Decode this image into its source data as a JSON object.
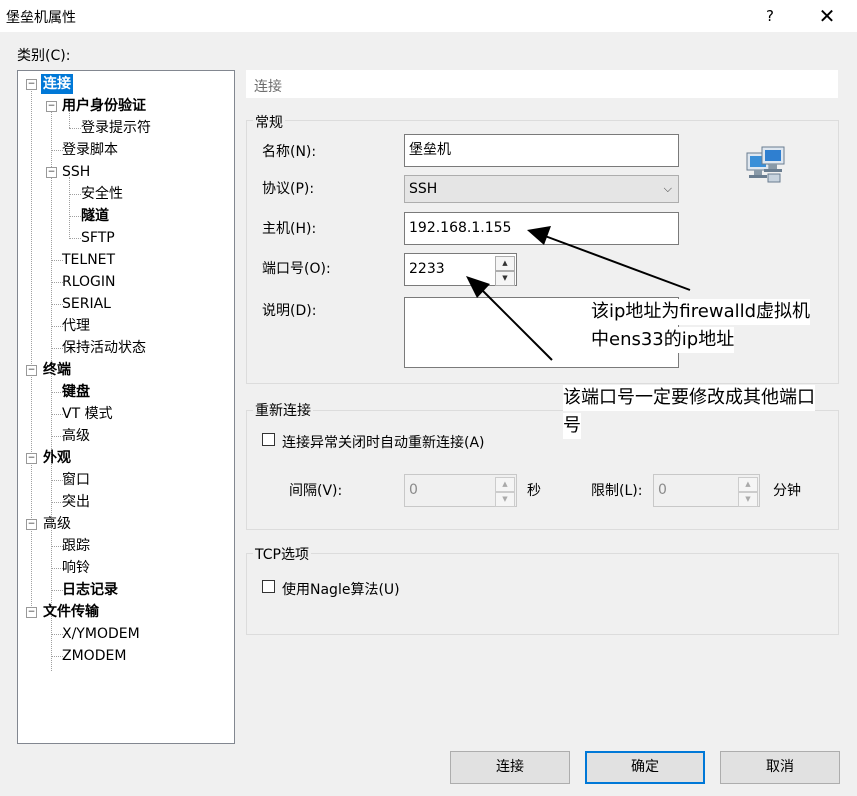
{
  "window": {
    "title": "堡垒机属性",
    "help": "?",
    "close": "✕"
  },
  "category_label": "类别(C):",
  "tree": {
    "lian_jie": "连接",
    "user_auth": "用户身份验证",
    "login_prompt": "登录提示符",
    "login_script": "登录脚本",
    "ssh": "SSH",
    "security": "安全性",
    "tunnel": "隧道",
    "sftp": "SFTP",
    "telnet": "TELNET",
    "rlogin": "RLOGIN",
    "serial": "SERIAL",
    "proxy": "代理",
    "keepalive": "保持活动状态",
    "terminal": "终端",
    "keyboard": "键盘",
    "vt_mode": "VT 模式",
    "term_advanced": "高级",
    "appearance": "外观",
    "window": "窗口",
    "highlight": "突出",
    "advanced": "高级",
    "trace": "跟踪",
    "bell": "响铃",
    "logging": "日志记录",
    "file_transfer": "文件传输",
    "xymodem": "X/YMODEM",
    "zmodem": "ZMODEM",
    "expand_minus": "−",
    "expand_plus": "+"
  },
  "section_title": "连接",
  "general": {
    "title": "常规",
    "name_label": "名称(N):",
    "name_value": "堡垒机",
    "protocol_label": "协议(P):",
    "protocol_value": "SSH",
    "protocol_arrow": "⌵",
    "host_label": "主机(H):",
    "host_value": "192.168.1.155",
    "port_label": "端口号(O):",
    "port_value": "2233",
    "spin_up": "▲",
    "spin_down": "▼",
    "desc_label": "说明(D):"
  },
  "reconnect": {
    "title": "重新连接",
    "checkbox_label": "连接异常关闭时自动重新连接(A)",
    "interval_label": "间隔(V):",
    "interval_value": "0",
    "seconds": "秒",
    "limit_label": "限制(L):",
    "limit_value": "0",
    "minutes": "分钟"
  },
  "tcp": {
    "title": "TCP选项",
    "nagle_label": "使用Nagle算法(U)"
  },
  "annotations": {
    "ip_note_line1": "该ip地址为firewalld虚拟机",
    "ip_note_line2": "中ens33的ip地址",
    "port_note_line1": "该端口号一定要修改成其他端口",
    "port_note_line2": "号"
  },
  "buttons": {
    "connect": "连接",
    "ok": "确定",
    "cancel": "取消"
  },
  "colors": {
    "selection": "#0078d7",
    "dialog_bg": "#f0f0f0"
  }
}
